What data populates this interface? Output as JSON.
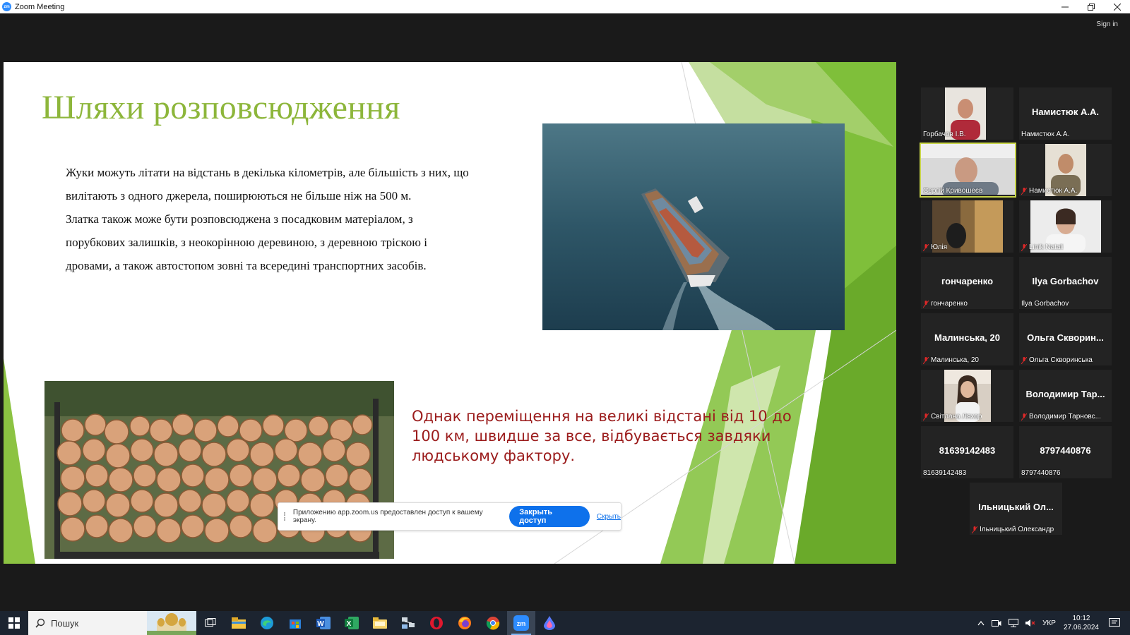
{
  "window": {
    "title": "Zoom Meeting",
    "app_icon": "zoom-logo-icon",
    "controls": [
      "minimize",
      "restore",
      "close"
    ]
  },
  "meeting": {
    "sign_in": "Sign in"
  },
  "slide": {
    "title": "Шляхи розповсюдження",
    "paragraph_lines": [
      "Жуки можуть літати на відстань в декілька кілометрів, але більшість з них, що",
      "вилітають з одного джерела, поширюються не більше ніж на 500 м.",
      "Златка також може бути розповсюджена з посадковим матеріалом, з",
      "порубкових залишків, з неокорінною деревиною, з деревною тріскою і",
      "дровами, а також  автостопом зовні та всередині транспортних засобів."
    ],
    "note_lines": [
      "Однак переміщення на великі відстані від 10 до",
      "100 км, швидше за все, відбувається завдяки",
      "людському фактору."
    ],
    "images": [
      "container-ship-photo",
      "firewood-stack-photo"
    ]
  },
  "share_bar": {
    "message": "Приложению app.zoom.us предоставлен доступ к вашему экрану.",
    "stop_button": "Закрыть доступ",
    "hide_link": "Скрыть"
  },
  "participants": [
    {
      "label": "Горбачов І.В.",
      "big": "",
      "video": true,
      "muted": false
    },
    {
      "label": "Намистюк А.А.",
      "big": "Намистюк А.А.",
      "video": false,
      "muted": false
    },
    {
      "label": "Сергій Кривошеєв",
      "big": "",
      "video": true,
      "muted": false,
      "active": true
    },
    {
      "label": "Намистюк А.А.",
      "big": "",
      "video": true,
      "muted": true
    },
    {
      "label": "Юлія",
      "big": "",
      "video": true,
      "muted": true
    },
    {
      "label": "Linik Natali",
      "big": "",
      "video": true,
      "muted": true
    },
    {
      "label": "гончаренко",
      "big": "гончаренко",
      "video": false,
      "muted": true
    },
    {
      "label": "Ilya Gorbachov",
      "big": "Ilya Gorbachov",
      "video": false,
      "muted": false
    },
    {
      "label": "Малинська, 20",
      "big": "Малинська, 20",
      "video": false,
      "muted": true
    },
    {
      "label": "Ольга Скворинська",
      "big": "Ольга Скворин...",
      "video": false,
      "muted": true
    },
    {
      "label": "Світлана Ляхор",
      "big": "",
      "video": true,
      "muted": true
    },
    {
      "label": "Володимир Тарновс...",
      "big": "Володимир Тар...",
      "video": false,
      "muted": true
    },
    {
      "label": "81639142483",
      "big": "81639142483",
      "video": false,
      "muted": false
    },
    {
      "label": "8797440876",
      "big": "8797440876",
      "video": false,
      "muted": false
    },
    {
      "label": "Ільницький Олександр",
      "big": "Ільницький Ол...",
      "video": false,
      "muted": true
    }
  ],
  "taskbar": {
    "search_placeholder": "Пошук",
    "apps": [
      "task-view-icon",
      "file-explorer-icon",
      "edge-icon",
      "store-icon",
      "word-icon",
      "excel-icon",
      "folder-icon",
      "network-app-icon",
      "opera-icon",
      "firefox-icon",
      "chrome-icon",
      "zoom-icon",
      "droplet-app-icon"
    ],
    "active_app": "zoom-icon",
    "tray_lang": "УКР",
    "time": "10:12",
    "date": "27.06.2024"
  }
}
